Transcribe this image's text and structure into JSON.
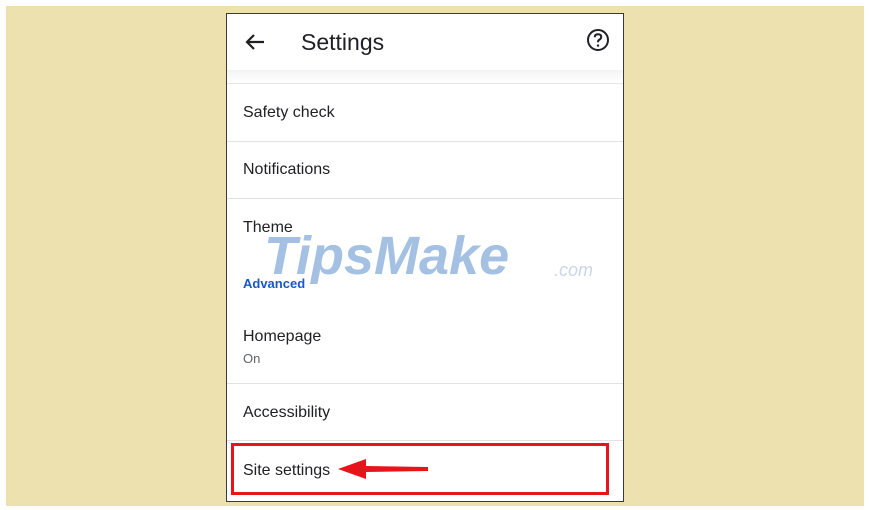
{
  "appbar": {
    "title": "Settings",
    "back_icon": "arrow-back-icon",
    "help_icon": "help-circle-icon"
  },
  "items": [
    {
      "label": "Safety check"
    },
    {
      "label": "Notifications"
    },
    {
      "label": "Theme"
    }
  ],
  "advanced_section": {
    "header": "Advanced",
    "items": [
      {
        "label": "Homepage",
        "sublabel": "On"
      },
      {
        "label": "Accessibility"
      },
      {
        "label": "Site settings"
      }
    ]
  },
  "watermark": {
    "text_main": "TipsMake",
    "text_suffix": ".com"
  },
  "annotation": {
    "highlight_color": "#e8141c",
    "arrow_icon": "red-arrow-left-icon"
  },
  "colors": {
    "backdrop": "#ede1b0",
    "accent": "#1a57c7"
  }
}
